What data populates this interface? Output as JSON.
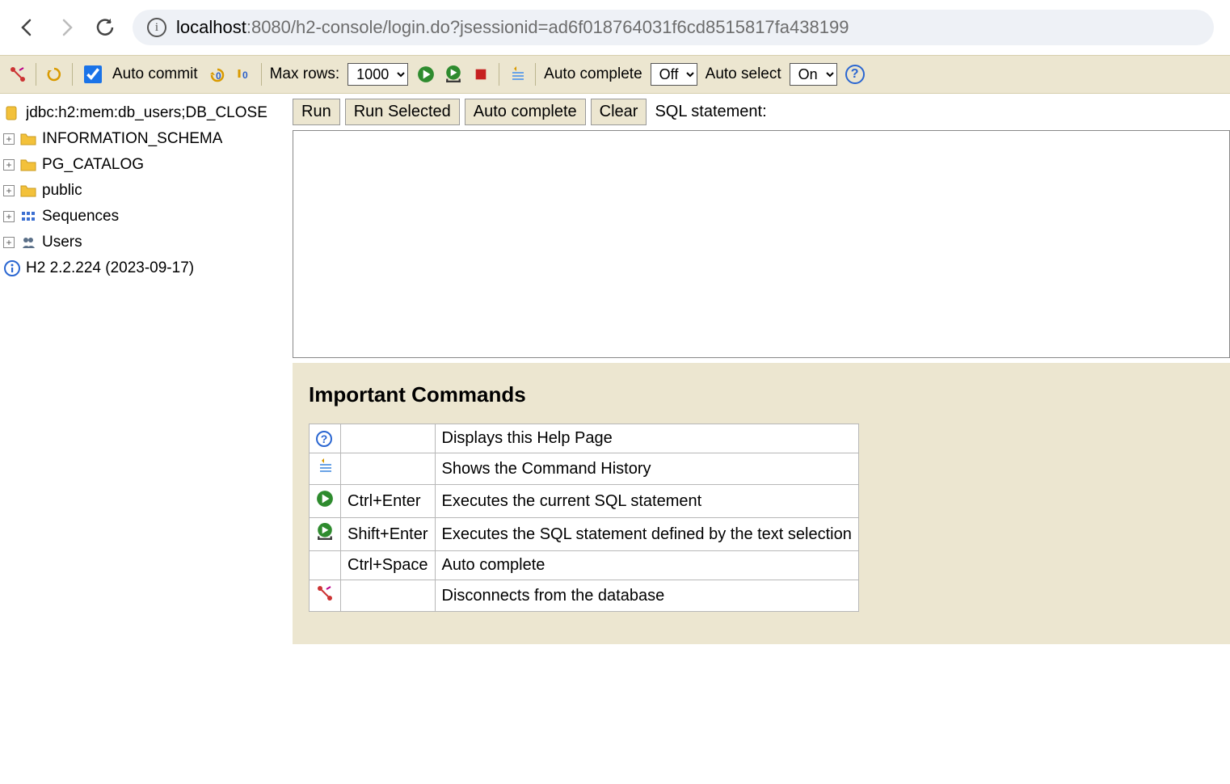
{
  "browser": {
    "url_host": "localhost",
    "url_rest": ":8080/h2-console/login.do?jsessionid=ad6f018764031f6cd8515817fa438199"
  },
  "toolbar": {
    "auto_commit_label": "Auto commit",
    "auto_commit_checked": true,
    "max_rows_label": "Max rows:",
    "max_rows_value": "1000",
    "auto_complete_label": "Auto complete",
    "auto_complete_value": "Off",
    "auto_select_label": "Auto select",
    "auto_select_value": "On"
  },
  "sidebar": {
    "db_url": "jdbc:h2:mem:db_users;DB_CLOSE",
    "items": [
      {
        "icon": "folder",
        "label": "INFORMATION_SCHEMA"
      },
      {
        "icon": "folder",
        "label": "PG_CATALOG"
      },
      {
        "icon": "folder",
        "label": "public"
      },
      {
        "icon": "sequences",
        "label": "Sequences"
      },
      {
        "icon": "users",
        "label": "Users"
      }
    ],
    "version": "H2 2.2.224 (2023-09-17)"
  },
  "sql": {
    "run": "Run",
    "run_selected": "Run Selected",
    "auto_complete": "Auto complete",
    "clear": "Clear",
    "label": "SQL statement:",
    "value": ""
  },
  "help": {
    "heading": "Important Commands",
    "rows": [
      {
        "icon": "help",
        "shortcut": "",
        "desc": "Displays this Help Page"
      },
      {
        "icon": "history",
        "shortcut": "",
        "desc": "Shows the Command History"
      },
      {
        "icon": "run",
        "shortcut": "Ctrl+Enter",
        "desc": "Executes the current SQL statement"
      },
      {
        "icon": "run-selected",
        "shortcut": "Shift+Enter",
        "desc": "Executes the SQL statement defined by the text selection"
      },
      {
        "icon": "",
        "shortcut": "Ctrl+Space",
        "desc": "Auto complete"
      },
      {
        "icon": "disconnect",
        "shortcut": "",
        "desc": "Disconnects from the database"
      }
    ]
  }
}
